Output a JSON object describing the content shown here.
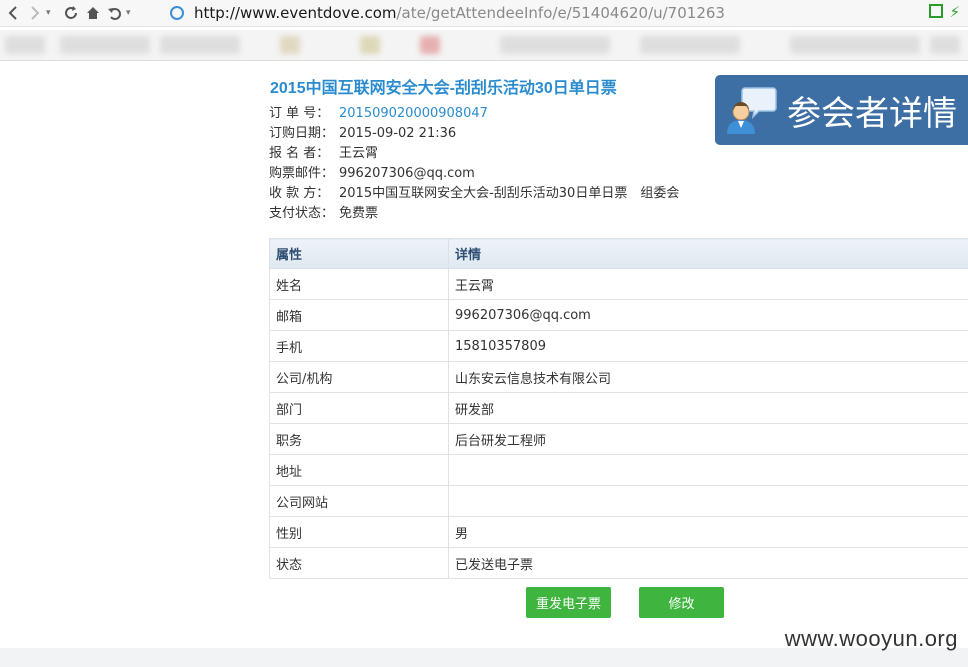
{
  "browser": {
    "url_host": "http://www.eventdove.com",
    "url_path": "/ate/getAttendeeInfo/e/51404620/u/701263",
    "icons": [
      "back-icon",
      "forward-icon",
      "reload-icon",
      "home-icon",
      "undo-icon"
    ]
  },
  "page": {
    "title": "2015中国互联网安全大会-刮刮乐活动30日单日票",
    "banner": "参会者详情"
  },
  "order_info": [
    {
      "key": "订 单 号：",
      "value": "201509020000908047",
      "is_link": true
    },
    {
      "key": "订购日期：",
      "value": "2015-09-02 21:36",
      "is_link": false
    },
    {
      "key": "报 名 者：",
      "value": "王云霄",
      "is_link": false
    },
    {
      "key": "购票邮件：",
      "value": "996207306@qq.com",
      "is_link": false
    },
    {
      "key": "收 款 方：",
      "value": "2015中国互联网安全大会-刮刮乐活动30日单日票　组委会",
      "is_link": false
    },
    {
      "key": "支付状态：",
      "value": "免费票",
      "is_link": false
    }
  ],
  "table": {
    "headers": [
      "属性",
      "详情"
    ],
    "rows": [
      [
        "姓名",
        "王云霄"
      ],
      [
        "邮箱",
        "996207306@qq.com"
      ],
      [
        "手机",
        "15810357809"
      ],
      [
        "公司/机构",
        "山东安云信息技术有限公司"
      ],
      [
        "部门",
        "研发部"
      ],
      [
        "职务",
        "后台研发工程师"
      ],
      [
        "地址",
        ""
      ],
      [
        "公司网站",
        ""
      ],
      [
        "性别",
        "男"
      ],
      [
        "状态",
        "已发送电子票"
      ]
    ]
  },
  "buttons": {
    "resend": "重发电子票",
    "edit": "修改"
  },
  "watermark": "www.wooyun.org",
  "colors": {
    "accent": "#2a8ccf",
    "banner_bg": "#3d6fa5",
    "button_green": "#3fb43f"
  }
}
